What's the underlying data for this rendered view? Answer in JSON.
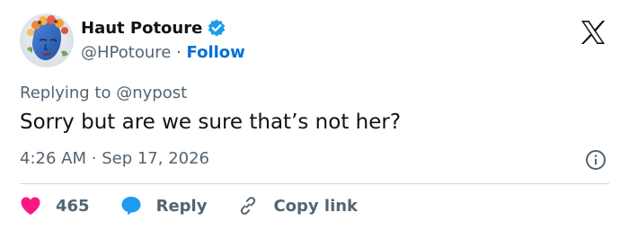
{
  "author": {
    "display_name": "Haut Potoure",
    "handle": "@HPotoure",
    "separator": "·",
    "follow_label": "Follow",
    "verified": true
  },
  "tweet": {
    "replying_to_prefix": "Replying to",
    "replying_to_handle": "@nypost",
    "text": "Sorry but are we sure that’s not her?",
    "time": "4:26 AM",
    "date": "Sep 17, 2026"
  },
  "actions": {
    "like_count": "465",
    "reply_label": "Reply",
    "copy_link_label": "Copy link"
  },
  "icons": {
    "brand": "x-logo-icon",
    "verified": "verified-badge-icon",
    "info": "info-icon",
    "like": "heart-icon",
    "reply": "speech-bubble-icon",
    "copy": "link-icon"
  },
  "colors": {
    "text": "#0f1419",
    "muted": "#536471",
    "link": "#006fd6",
    "verified": "#1d9bf0",
    "like": "#f91880",
    "reply": "#1d9bf0",
    "divider": "#cfd9de"
  }
}
